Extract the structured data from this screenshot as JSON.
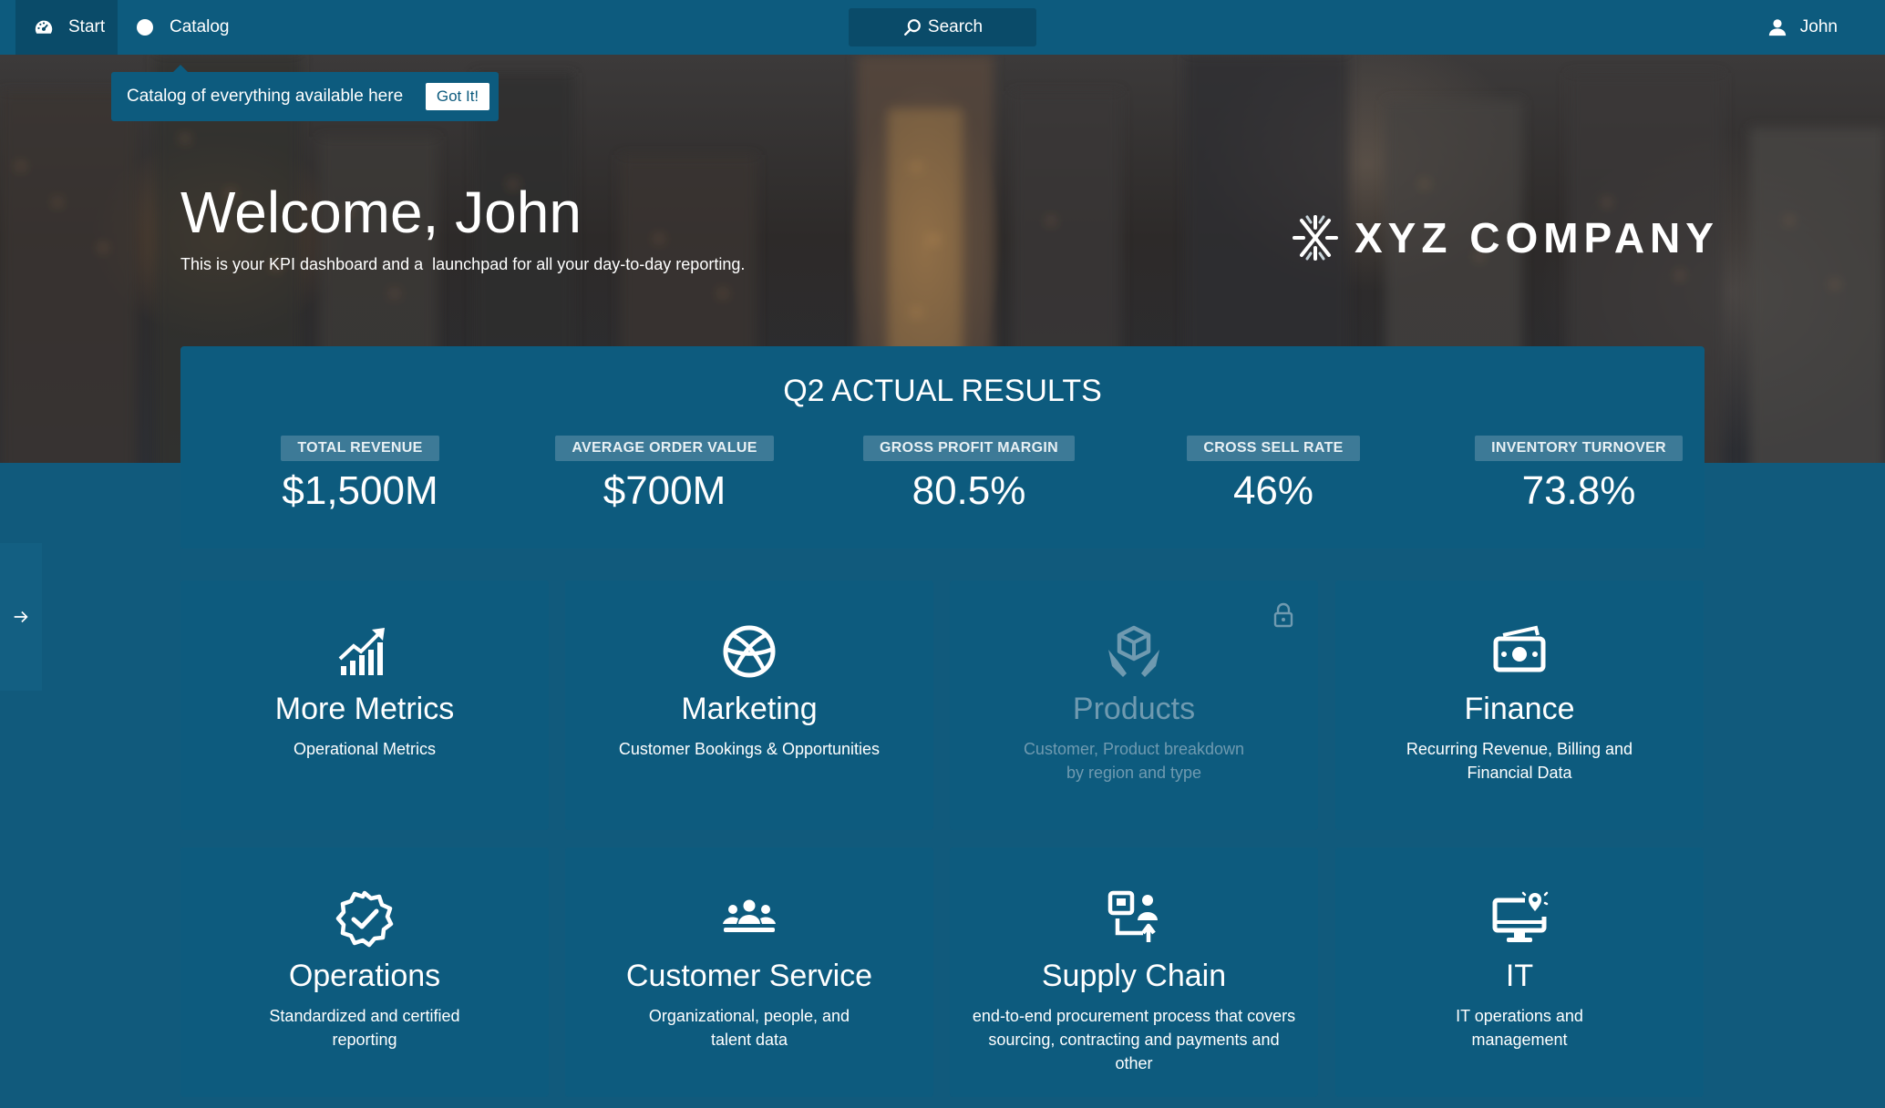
{
  "nav": {
    "start_label": "Start",
    "catalog_label": "Catalog",
    "search_label": "Search",
    "user_label": "John"
  },
  "tooltip": {
    "text": "Catalog of everything available here",
    "button_label": "Got It!"
  },
  "hero": {
    "welcome": "Welcome, John",
    "subtitle": "This is your KPI dashboard and a  launchpad for all your day-to-day reporting.",
    "company": "XYZ COMPANY"
  },
  "kpi": {
    "title": "Q2 ACTUAL RESULTS",
    "items": [
      {
        "label": "TOTAL REVENUE",
        "value": "$1,500M"
      },
      {
        "label": "AVERAGE ORDER VALUE",
        "value": "$700M"
      },
      {
        "label": "GROSS PROFIT MARGIN",
        "value": "80.5%"
      },
      {
        "label": "CROSS SELL RATE",
        "value": "46%"
      },
      {
        "label": "INVENTORY TURNOVER",
        "value": "73.8%"
      }
    ]
  },
  "tiles": [
    {
      "name": "More Metrics",
      "desc": "Operational Metrics",
      "icon": "chart-growth-icon",
      "locked": false
    },
    {
      "name": "Marketing",
      "desc": "Customer Bookings & Opportunities",
      "icon": "globe-icon",
      "locked": false
    },
    {
      "name": "Products",
      "desc": "Customer, Product breakdown by region and type",
      "icon": "box-hands-icon",
      "locked": true
    },
    {
      "name": "Finance",
      "desc": "Recurring Revenue, Billing and Financial Data",
      "icon": "money-icon",
      "locked": false
    },
    {
      "name": "Operations",
      "desc": "Standardized and certified reporting",
      "icon": "badge-check-icon",
      "locked": false
    },
    {
      "name": "Customer Service",
      "desc": "Organizational, people, and talent data",
      "icon": "people-group-icon",
      "locked": false
    },
    {
      "name": "Supply Chain",
      "desc": "end-to-end procurement process that covers sourcing, contracting and payments and other",
      "icon": "supply-transfer-icon",
      "locked": false
    },
    {
      "name": "IT",
      "desc": "IT operations and management",
      "icon": "monitor-pin-icon",
      "locked": false
    }
  ],
  "colors": {
    "nav_bg": "#0d5b7e",
    "page_bg": "#115a7c",
    "tile_bg": "#0d5b7e",
    "kpi_label_bg": "#3d7a97",
    "locked_text": "#6f9ab0"
  }
}
